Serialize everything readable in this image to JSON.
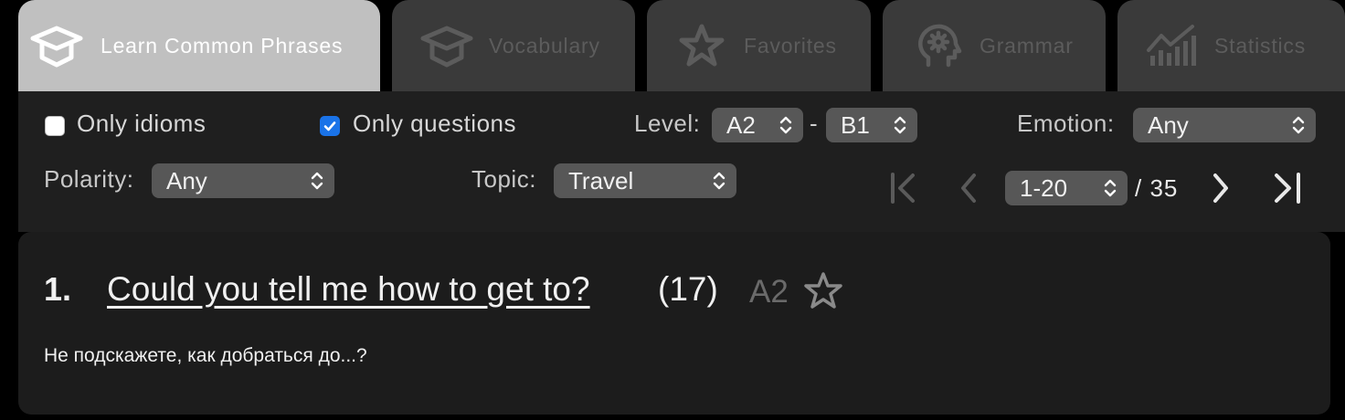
{
  "tabs": [
    {
      "label": "Learn Common Phrases",
      "icon": "graduation-cap-icon",
      "active": true
    },
    {
      "label": "Vocabulary",
      "icon": "graduation-cap-icon",
      "active": false
    },
    {
      "label": "Favorites",
      "icon": "star-icon",
      "active": false
    },
    {
      "label": "Grammar",
      "icon": "head-gear-icon",
      "active": false
    },
    {
      "label": "Statistics",
      "icon": "bar-chart-icon",
      "active": false
    }
  ],
  "filters": {
    "only_idioms": {
      "label": "Only idioms",
      "checked": false
    },
    "only_questions": {
      "label": "Only questions",
      "checked": true
    },
    "level": {
      "label": "Level:",
      "from": "A2",
      "separator": "-",
      "to": "B1"
    },
    "emotion": {
      "label": "Emotion:",
      "value": "Any"
    },
    "polarity": {
      "label": "Polarity:",
      "value": "Any"
    },
    "topic": {
      "label": "Topic:",
      "value": "Travel"
    }
  },
  "pager": {
    "range": "1-20",
    "total": "/ 35"
  },
  "phrase": {
    "number": "1.",
    "text": "Could you tell me how to get to?",
    "count": "(17)",
    "level": "A2",
    "translation": "Не подскажете, как добраться до...?"
  },
  "colors": {
    "active_tab": "#c0c0c0",
    "inactive_tab": "#3a3a3a",
    "panel": "#1f1f1f",
    "select": "#575757",
    "checkbox_accent": "#1a73e8"
  }
}
